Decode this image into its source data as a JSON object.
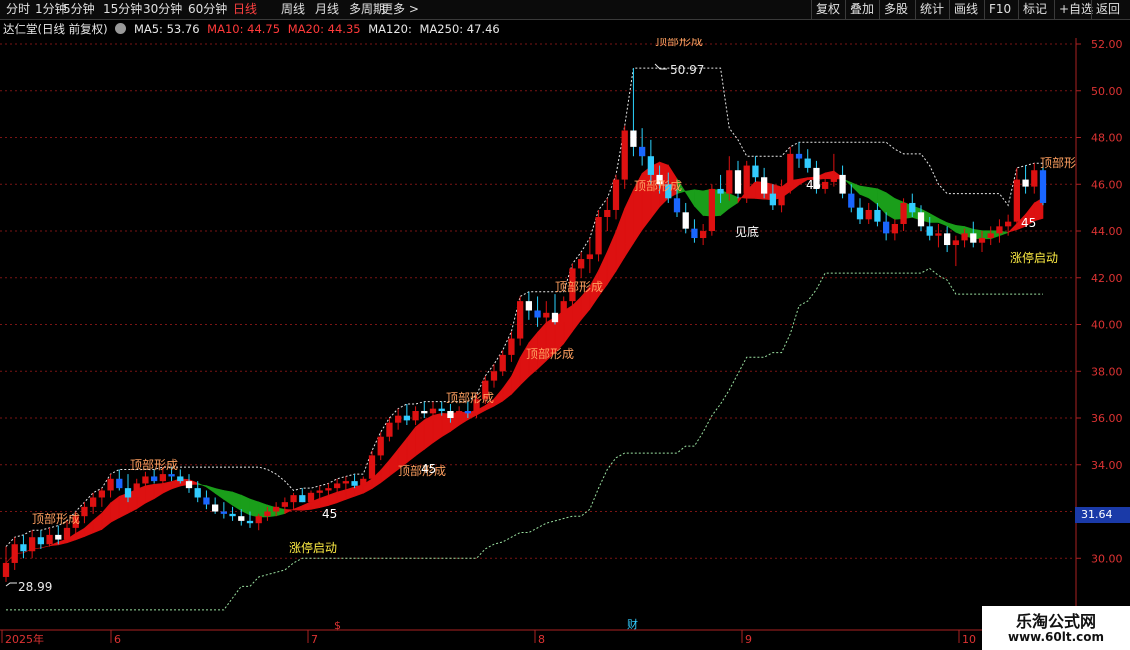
{
  "toolbar": {
    "left": [
      "分时",
      "1分钟",
      "5分钟",
      "15分钟",
      "30分钟",
      "60分钟",
      "日线",
      "周线",
      "月线",
      "多周期",
      "更多 >"
    ],
    "active": "日线",
    "right": [
      "复权",
      "叠加",
      "多股",
      "统计",
      "画线",
      "F10",
      "标记",
      "+自选",
      "返回"
    ]
  },
  "info": {
    "title": "达仁堂(日线 前复权)",
    "ma5": "MA5: 53.76",
    "ma10": "MA10: 44.75",
    "ma20": "MA20: 44.35",
    "ma120": "MA120:",
    "ma250": "MA250: 47.46"
  },
  "current_price": "31.64",
  "watermark": {
    "name": "乐淘公式网",
    "url": "www.60lt.com"
  },
  "colors": {
    "up": "#dd1111",
    "down_a": "#33ccff",
    "down_b": "#1a66ff",
    "grid": "#7a1414",
    "band_up": "#dd1111",
    "band_down": "#1a9e1a"
  },
  "chart_data": {
    "type": "candlestick",
    "y_ticks": [
      "52.00",
      "50.00",
      "48.00",
      "46.00",
      "44.00",
      "42.00",
      "40.00",
      "38.00",
      "36.00",
      "34.00",
      "32.00",
      "30.00"
    ],
    "ylim": [
      28.3,
      52.3
    ],
    "x_labels": [
      "2025年",
      "6",
      "7",
      "8",
      "9",
      "10"
    ],
    "event_markers": [
      "$",
      "财"
    ],
    "annotations": {
      "top_formed": "顶部形成",
      "limit_start": "涨停启动",
      "see_bottom": "见底",
      "top_formed_short": "顶部形",
      "num_45": "45",
      "low_mark": "28.99",
      "high_mark": "50.97"
    },
    "candles": [
      [
        29.2,
        30.5,
        28.99,
        29.8
      ],
      [
        29.8,
        30.9,
        29.5,
        30.6
      ],
      [
        30.6,
        31.0,
        30.0,
        30.3
      ],
      [
        30.3,
        31.2,
        30.0,
        30.9
      ],
      [
        30.9,
        31.2,
        30.4,
        30.6
      ],
      [
        30.6,
        31.3,
        30.5,
        31.0
      ],
      [
        31.0,
        31.4,
        30.6,
        30.8
      ],
      [
        30.8,
        31.6,
        30.7,
        31.3
      ],
      [
        31.3,
        32.0,
        31.0,
        31.8
      ],
      [
        31.8,
        32.4,
        31.5,
        32.2
      ],
      [
        32.2,
        32.8,
        31.9,
        32.6
      ],
      [
        32.6,
        33.0,
        32.2,
        32.9
      ],
      [
        32.9,
        33.6,
        32.6,
        33.4
      ],
      [
        33.4,
        33.8,
        32.9,
        33.0
      ],
      [
        33.0,
        33.6,
        32.4,
        32.6
      ],
      [
        32.6,
        33.4,
        32.3,
        33.2
      ],
      [
        33.2,
        33.7,
        33.0,
        33.5
      ],
      [
        33.5,
        33.8,
        33.2,
        33.3
      ],
      [
        33.3,
        33.9,
        33.1,
        33.6
      ],
      [
        33.6,
        33.9,
        33.3,
        33.5
      ],
      [
        33.5,
        33.8,
        33.2,
        33.3
      ],
      [
        33.3,
        33.6,
        32.8,
        33.0
      ],
      [
        33.0,
        33.3,
        32.4,
        32.6
      ],
      [
        32.6,
        32.9,
        32.1,
        32.3
      ],
      [
        32.3,
        32.6,
        31.9,
        32.0
      ],
      [
        32.0,
        32.4,
        31.7,
        31.9
      ],
      [
        31.9,
        32.2,
        31.6,
        31.8
      ],
      [
        31.8,
        32.1,
        31.4,
        31.6
      ],
      [
        31.6,
        32.0,
        31.3,
        31.5
      ],
      [
        31.5,
        31.9,
        31.2,
        31.8
      ],
      [
        31.8,
        32.2,
        31.6,
        32.0
      ],
      [
        32.0,
        32.4,
        31.8,
        32.2
      ],
      [
        32.2,
        32.6,
        31.9,
        32.4
      ],
      [
        32.4,
        32.8,
        32.1,
        32.7
      ],
      [
        32.7,
        33.0,
        32.4,
        32.4
      ],
      [
        32.4,
        32.9,
        32.3,
        32.8
      ],
      [
        32.8,
        33.1,
        32.5,
        32.9
      ],
      [
        32.9,
        33.2,
        32.7,
        33.0
      ],
      [
        33.0,
        33.4,
        32.8,
        33.2
      ],
      [
        33.2,
        33.5,
        32.9,
        33.3
      ],
      [
        33.3,
        33.6,
        33.0,
        33.1
      ],
      [
        33.1,
        33.5,
        33.0,
        33.4
      ],
      [
        33.4,
        34.6,
        33.3,
        34.4
      ],
      [
        34.4,
        35.4,
        34.2,
        35.2
      ],
      [
        35.2,
        36.0,
        35.0,
        35.8
      ],
      [
        35.8,
        36.4,
        35.5,
        36.1
      ],
      [
        36.1,
        36.6,
        35.7,
        35.9
      ],
      [
        35.9,
        36.5,
        35.7,
        36.3
      ],
      [
        36.3,
        36.7,
        36.0,
        36.2
      ],
      [
        36.2,
        36.7,
        35.9,
        36.4
      ],
      [
        36.4,
        36.7,
        36.1,
        36.3
      ],
      [
        36.3,
        36.6,
        35.8,
        36.0
      ],
      [
        36.0,
        36.5,
        35.7,
        36.3
      ],
      [
        36.3,
        36.7,
        36.0,
        36.2
      ],
      [
        36.2,
        37.0,
        36.0,
        36.8
      ],
      [
        36.8,
        37.8,
        36.6,
        37.6
      ],
      [
        37.6,
        38.3,
        37.3,
        38.0
      ],
      [
        38.0,
        38.9,
        37.8,
        38.7
      ],
      [
        38.7,
        39.7,
        38.4,
        39.4
      ],
      [
        39.4,
        41.2,
        39.1,
        41.0
      ],
      [
        41.0,
        41.4,
        40.2,
        40.6
      ],
      [
        40.6,
        41.2,
        39.9,
        40.3
      ],
      [
        40.3,
        41.0,
        39.8,
        40.5
      ],
      [
        40.5,
        41.3,
        40.0,
        40.1
      ],
      [
        40.1,
        41.2,
        40.0,
        41.0
      ],
      [
        41.0,
        42.6,
        40.8,
        42.4
      ],
      [
        42.4,
        43.1,
        42.0,
        42.8
      ],
      [
        42.8,
        43.7,
        42.2,
        43.0
      ],
      [
        43.0,
        44.9,
        42.7,
        44.6
      ],
      [
        44.6,
        45.4,
        44.0,
        44.9
      ],
      [
        44.9,
        46.4,
        44.5,
        46.2
      ],
      [
        46.2,
        48.5,
        45.8,
        48.3
      ],
      [
        48.3,
        50.97,
        47.2,
        47.6
      ],
      [
        47.6,
        48.4,
        46.8,
        47.2
      ],
      [
        47.2,
        47.9,
        46.0,
        46.4
      ],
      [
        46.4,
        46.8,
        45.6,
        46.0
      ],
      [
        46.0,
        46.5,
        45.2,
        45.4
      ],
      [
        45.4,
        45.8,
        44.6,
        44.8
      ],
      [
        44.8,
        45.2,
        43.9,
        44.1
      ],
      [
        44.1,
        44.5,
        43.5,
        43.7
      ],
      [
        43.7,
        44.3,
        43.4,
        44.0
      ],
      [
        44.0,
        46.0,
        43.8,
        45.8
      ],
      [
        45.8,
        46.4,
        45.2,
        45.6
      ],
      [
        45.6,
        47.2,
        45.3,
        46.6
      ],
      [
        46.6,
        47.0,
        45.4,
        45.6
      ],
      [
        45.6,
        47.0,
        45.2,
        46.8
      ],
      [
        46.8,
        47.2,
        46.1,
        46.3
      ],
      [
        46.3,
        46.7,
        45.4,
        45.6
      ],
      [
        45.6,
        46.0,
        44.9,
        45.1
      ],
      [
        45.1,
        46.2,
        44.8,
        45.9
      ],
      [
        45.9,
        47.6,
        45.6,
        47.3
      ],
      [
        47.3,
        47.8,
        46.7,
        47.1
      ],
      [
        47.1,
        47.5,
        46.5,
        46.7
      ],
      [
        46.7,
        47.0,
        45.6,
        45.8
      ],
      [
        45.8,
        46.3,
        45.6,
        46.1
      ],
      [
        46.1,
        47.3,
        45.9,
        46.4
      ],
      [
        46.4,
        46.8,
        45.4,
        45.6
      ],
      [
        45.6,
        46.0,
        44.8,
        45.0
      ],
      [
        45.0,
        45.4,
        44.3,
        44.5
      ],
      [
        44.5,
        45.2,
        44.3,
        44.9
      ],
      [
        44.9,
        45.2,
        44.2,
        44.4
      ],
      [
        44.4,
        44.8,
        43.6,
        43.9
      ],
      [
        43.9,
        44.5,
        43.6,
        44.3
      ],
      [
        44.3,
        45.4,
        44.0,
        45.2
      ],
      [
        45.2,
        45.6,
        44.6,
        44.8
      ],
      [
        44.8,
        45.1,
        44.0,
        44.2
      ],
      [
        44.2,
        44.6,
        43.6,
        43.8
      ],
      [
        43.8,
        44.3,
        43.3,
        43.9
      ],
      [
        43.9,
        44.2,
        43.1,
        43.4
      ],
      [
        43.4,
        43.8,
        42.5,
        43.6
      ],
      [
        43.6,
        44.1,
        43.3,
        43.9
      ],
      [
        43.9,
        44.4,
        43.3,
        43.5
      ],
      [
        43.5,
        44.0,
        43.1,
        43.7
      ],
      [
        43.7,
        44.2,
        43.4,
        43.9
      ],
      [
        43.9,
        44.5,
        43.5,
        44.2
      ],
      [
        44.2,
        44.7,
        43.8,
        44.4
      ],
      [
        44.4,
        46.7,
        44.2,
        46.2
      ],
      [
        46.2,
        46.8,
        45.6,
        45.9
      ],
      [
        45.9,
        46.9,
        45.6,
        46.6
      ],
      [
        46.6,
        46.8,
        45.1,
        45.2
      ]
    ]
  }
}
